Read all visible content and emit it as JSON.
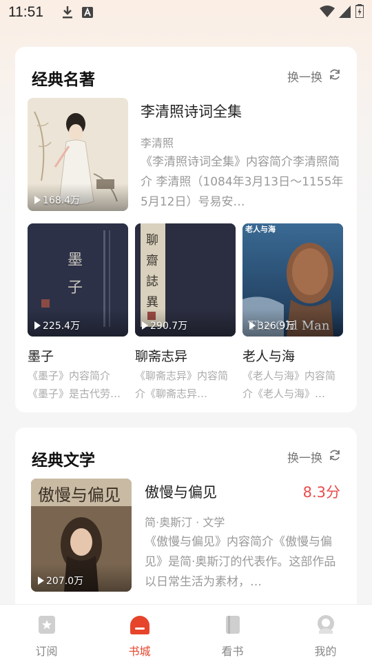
{
  "status_bar": {
    "time": "11:51"
  },
  "sections": [
    {
      "title": "经典名著",
      "refresh_label": "换一换",
      "featured": {
        "title": "李清照诗词全集",
        "author": "李清照",
        "description": "《李清照诗词全集》内容简介李清照简介  李清照（1084年3月13日～1155年5月12日）号易安…",
        "plays": "168.4万"
      },
      "books": [
        {
          "title": "墨子",
          "description": "《墨子》内容简介《墨子》是古代劳…",
          "plays": "225.4万"
        },
        {
          "title": "聊斋志异",
          "description": "《聊斋志异》内容简介《聊斋志异…",
          "plays": "290.7万"
        },
        {
          "title": "老人与海",
          "description": "《老人与海》内容简介《老人与海》…",
          "plays": "326.9万"
        }
      ]
    },
    {
      "title": "经典文学",
      "refresh_label": "换一换",
      "featured": {
        "title": "傲慢与偏见",
        "score": "8.3分",
        "author": "简·奥斯汀 · 文学",
        "description": "《傲慢与偏见》内容简介《傲慢与偏见》是简·奥斯汀的代表作。这部作品以日常生活为素材，…",
        "plays": "207.0万"
      }
    }
  ],
  "tabs": [
    {
      "label": "订阅",
      "icon": "star-bookmark-icon"
    },
    {
      "label": "书城",
      "icon": "bookstore-icon",
      "active": true
    },
    {
      "label": "看书",
      "icon": "book-icon"
    },
    {
      "label": "我的",
      "icon": "profile-icon"
    }
  ],
  "colors": {
    "accent": "#e6452c",
    "score": "#e94b4b"
  }
}
